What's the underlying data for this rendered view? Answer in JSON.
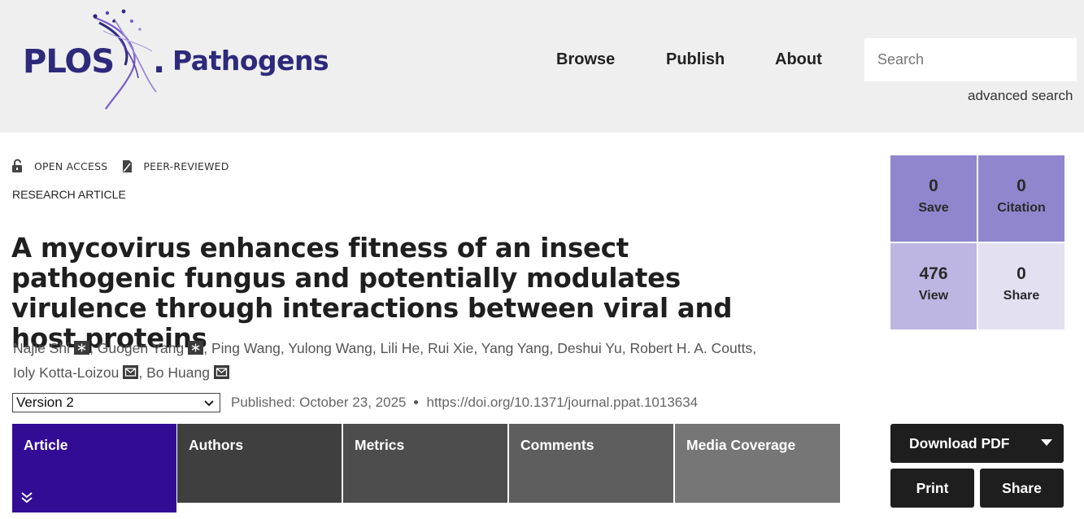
{
  "brand": {
    "name_left": "PLOS",
    "name_dot": ".",
    "name_right": "Pathogens",
    "color": "#2d2a7c"
  },
  "nav": {
    "browse": "Browse",
    "publish": "Publish",
    "about": "About"
  },
  "search": {
    "placeholder": "Search",
    "advanced": "advanced search"
  },
  "badges": {
    "open_access": "OPEN ACCESS",
    "peer_reviewed": "PEER-REVIEWED",
    "article_type": "RESEARCH ARTICLE"
  },
  "article": {
    "title": "A mycovirus enhances fitness of an insect pathogenic fungus and potentially modulates virulence through interactions between viral and host proteins",
    "authors": [
      {
        "name": "Najie Shi",
        "icon": "equal-contribution-icon"
      },
      {
        "name": "Guogen Yang",
        "icon": "equal-contribution-icon"
      },
      {
        "name": "Ping Wang"
      },
      {
        "name": "Yulong Wang"
      },
      {
        "name": "Lili He"
      },
      {
        "name": "Rui Xie"
      },
      {
        "name": "Yang Yang"
      },
      {
        "name": "Deshui Yu"
      },
      {
        "name": "Robert H. A. Coutts"
      },
      {
        "name": "Ioly Kotta-Loizou",
        "icon": "email-icon"
      },
      {
        "name": "Bo Huang",
        "icon": "email-icon"
      }
    ],
    "version": "Version 2",
    "published": "Published: October 23, 2025",
    "doi": "https://doi.org/10.1371/journal.ppat.1013634"
  },
  "tabs": [
    {
      "label": "Article",
      "active": true
    },
    {
      "label": "Authors"
    },
    {
      "label": "Metrics"
    },
    {
      "label": "Comments"
    },
    {
      "label": "Media Coverage"
    }
  ],
  "metrics": {
    "save": {
      "value": "0",
      "label": "Save"
    },
    "citation": {
      "value": "0",
      "label": "Citation"
    },
    "view": {
      "value": "476",
      "label": "View"
    },
    "share": {
      "value": "0",
      "label": "Share"
    }
  },
  "actions": {
    "download": "Download PDF",
    "print": "Print",
    "share": "Share"
  },
  "colors": {
    "accent": "#330c96",
    "header_bg": "#efefef",
    "metric_dark": "#8f86cd",
    "metric_mid": "#bdb6e2",
    "metric_light": "#e3e0f1"
  }
}
